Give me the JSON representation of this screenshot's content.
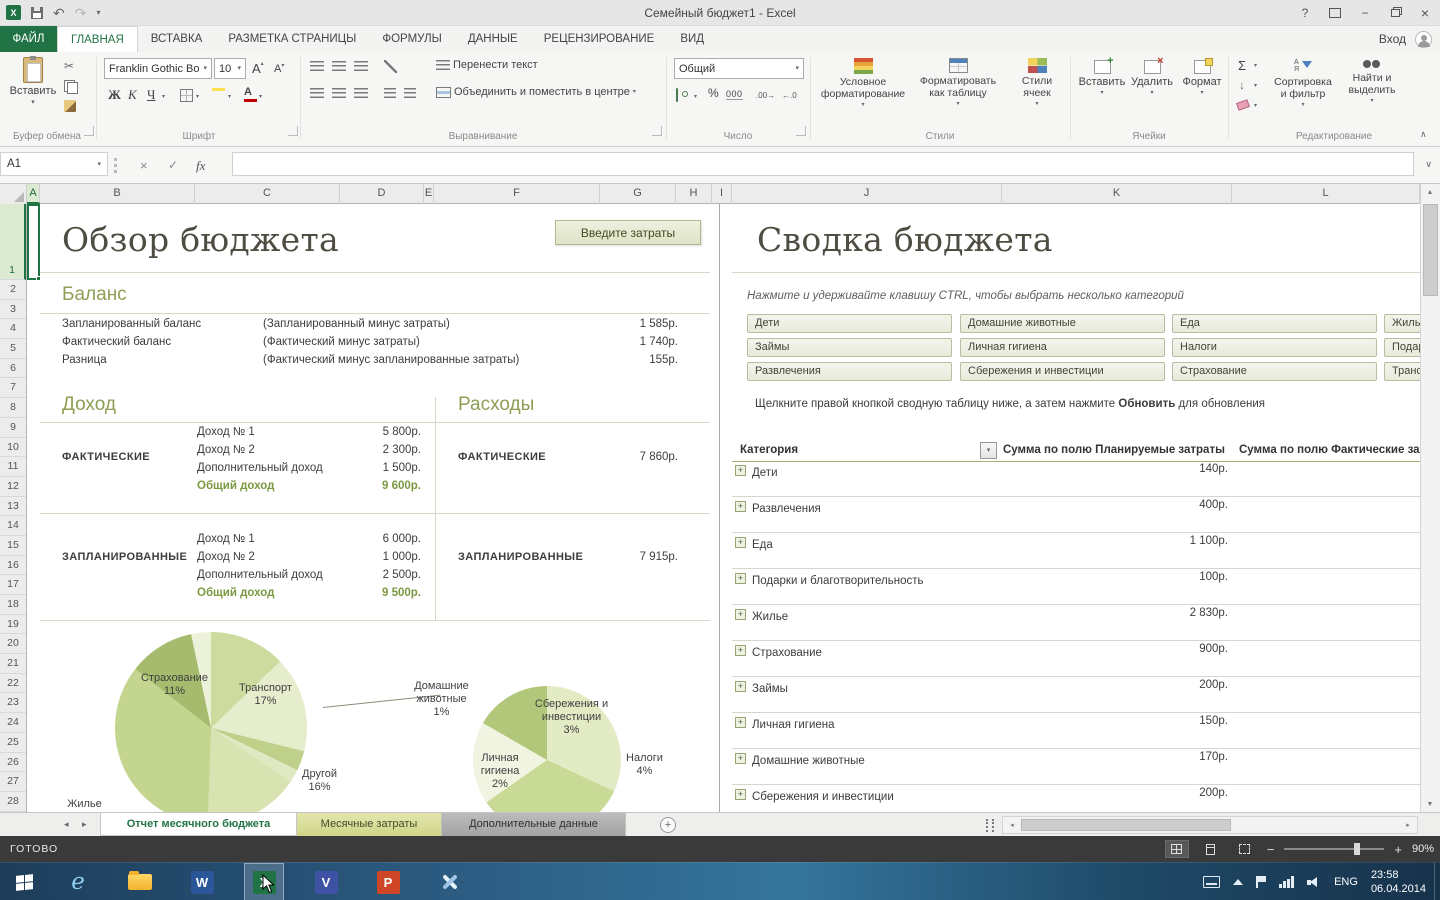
{
  "titlebar": {
    "title": "Семейный бюджет1 - Excel",
    "sign_in": "Вход"
  },
  "tabs": {
    "file": "ФАЙЛ",
    "items": [
      "ГЛАВНАЯ",
      "ВСТАВКА",
      "РАЗМЕТКА СТРАНИЦЫ",
      "ФОРМУЛЫ",
      "ДАННЫЕ",
      "РЕЦЕНЗИРОВАНИЕ",
      "ВИД"
    ]
  },
  "ribbon": {
    "clipboard_label": "Буфер обмена",
    "paste": "Вставить",
    "font_label": "Шрифт",
    "font_name": "Franklin Gothic Bo",
    "font_size": "10",
    "bold": "Ж",
    "italic": "К",
    "underline": "Ч",
    "align_label": "Выравнивание",
    "wrap_text": "Перенести текст",
    "merge_center": "Объединить и поместить в центре",
    "number_label": "Число",
    "number_format": "Общий",
    "percent": "%",
    "thousands": "000",
    "styles_label": "Стили",
    "conditional_1": "Условное",
    "conditional_2": "форматирование",
    "astable_1": "Форматировать",
    "astable_2": "как таблицу",
    "cellstyles_1": "Стили",
    "cellstyles_2": "ячеек",
    "cells_label": "Ячейки",
    "insert": "Вставить",
    "delete": "Удалить",
    "format": "Формат",
    "edit_label": "Редактирование",
    "sigma": "Σ",
    "sort_1": "Сортировка",
    "sort_2": "и фильтр",
    "find_1": "Найти и",
    "find_2": "выделить"
  },
  "formula_bar": {
    "name_box": "A1",
    "fx": "fx"
  },
  "sheet": {
    "cols": [
      "A",
      "B",
      "C",
      "D",
      "E",
      "F",
      "G",
      "H",
      "I",
      "J",
      "K",
      "L"
    ],
    "rows": [
      "1",
      "2",
      "3",
      "4",
      "5",
      "6",
      "7",
      "8",
      "9",
      "10",
      "11",
      "12",
      "13",
      "14",
      "15",
      "16",
      "17",
      "18",
      "19",
      "20",
      "21",
      "22",
      "23",
      "24",
      "25",
      "26",
      "27",
      "28"
    ]
  },
  "overview": {
    "title": "Обзор бюджета",
    "button": "Введите затраты",
    "balance_heading": "Баланс",
    "balance": [
      {
        "label": "Запланированный баланс",
        "note": "(Запланированный минус затраты)",
        "value": "1 585р."
      },
      {
        "label": "Фактический баланс",
        "note": "(Фактический минус затраты)",
        "value": "1 740р."
      },
      {
        "label": "Разница",
        "note": "(Фактический минус запланированные затраты)",
        "value": "155р."
      }
    ],
    "income_heading": "Доход",
    "expense_heading": "Расходы",
    "actual_label": "ФАКТИЧЕСКИЕ",
    "planned_label": "ЗАПЛАНИРОВАННЫЕ",
    "actual_rows": [
      {
        "name": "Доход № 1",
        "value": "5 800р."
      },
      {
        "name": "Доход № 2",
        "value": "2 300р."
      },
      {
        "name": "Дополнительный доход",
        "value": "1 500р."
      }
    ],
    "actual_total": {
      "name": "Общий доход",
      "value": "9 600р."
    },
    "planned_rows": [
      {
        "name": "Доход № 1",
        "value": "6 000р."
      },
      {
        "name": "Доход № 2",
        "value": "1 000р."
      },
      {
        "name": "Дополнительный доход",
        "value": "2 500р."
      }
    ],
    "planned_total": {
      "name": "Общий доход",
      "value": "9 500р."
    },
    "expense_actual": {
      "label": "ФАКТИЧЕСКИЕ",
      "value": "7 860р."
    },
    "expense_planned": {
      "label": "ЗАПЛАНИРОВАННЫЕ",
      "value": "7 915р."
    },
    "chart": {
      "labels": [
        {
          "name": "Страхование",
          "pct": "11%"
        },
        {
          "name": "Транспорт",
          "pct": "17%"
        },
        {
          "name": "Жилье",
          "pct": ""
        },
        {
          "name": "Другой",
          "pct": "16%"
        },
        {
          "name": "Домашние животные",
          "pct": "1%"
        },
        {
          "name": "Сбережения и инвестиции",
          "pct": "3%"
        },
        {
          "name": "Личная гигиена",
          "pct": "2%"
        },
        {
          "name": "Налоги",
          "pct": "4%"
        }
      ]
    }
  },
  "summary": {
    "title": "Сводка бюджета",
    "hint": "Нажмите и удерживайте клавишу CTRL, чтобы выбрать несколько категорий",
    "slicers": [
      "Дети",
      "Домашние животные",
      "Еда",
      "Жилье",
      "Займы",
      "Личная гигиена",
      "Налоги",
      "Подарки и благотворительность",
      "Развлечения",
      "Сбережения и инвестиции",
      "Страхование",
      "Транспорт"
    ],
    "note_1": "Щелкните правой кнопкой сводную таблицу ниже, а затем нажмите ",
    "note_bold": "Обновить",
    "note_2": " для обновления",
    "pivot_category": "Категория",
    "pivot_planned": "Сумма по полю Планируемые затраты",
    "pivot_actual": "Сумма по полю Фактические затраты",
    "pivot_rows": [
      {
        "label": "Дети",
        "value": "140р."
      },
      {
        "label": "Развлечения",
        "value": "400р."
      },
      {
        "label": "Еда",
        "value": "1 100р."
      },
      {
        "label": "Подарки и благотворительность",
        "value": "100р."
      },
      {
        "label": "Жилье",
        "value": "2 830р."
      },
      {
        "label": "Страхование",
        "value": "900р."
      },
      {
        "label": "Займы",
        "value": "200р."
      },
      {
        "label": "Личная гигиена",
        "value": "150р."
      },
      {
        "label": "Домашние животные",
        "value": "170р."
      },
      {
        "label": "Сбережения и инвестиции",
        "value": "200р."
      }
    ]
  },
  "sheet_tabs": {
    "t0": "Отчет месячного бюджета",
    "t1": "Месячные затраты",
    "t2": "Дополнительные данные",
    "add": "+"
  },
  "status": {
    "ready": "ГОТОВО",
    "zoom": "90%"
  },
  "taskbar": {
    "lang": "ENG",
    "time": "23:58",
    "date": "06.04.2014"
  }
}
